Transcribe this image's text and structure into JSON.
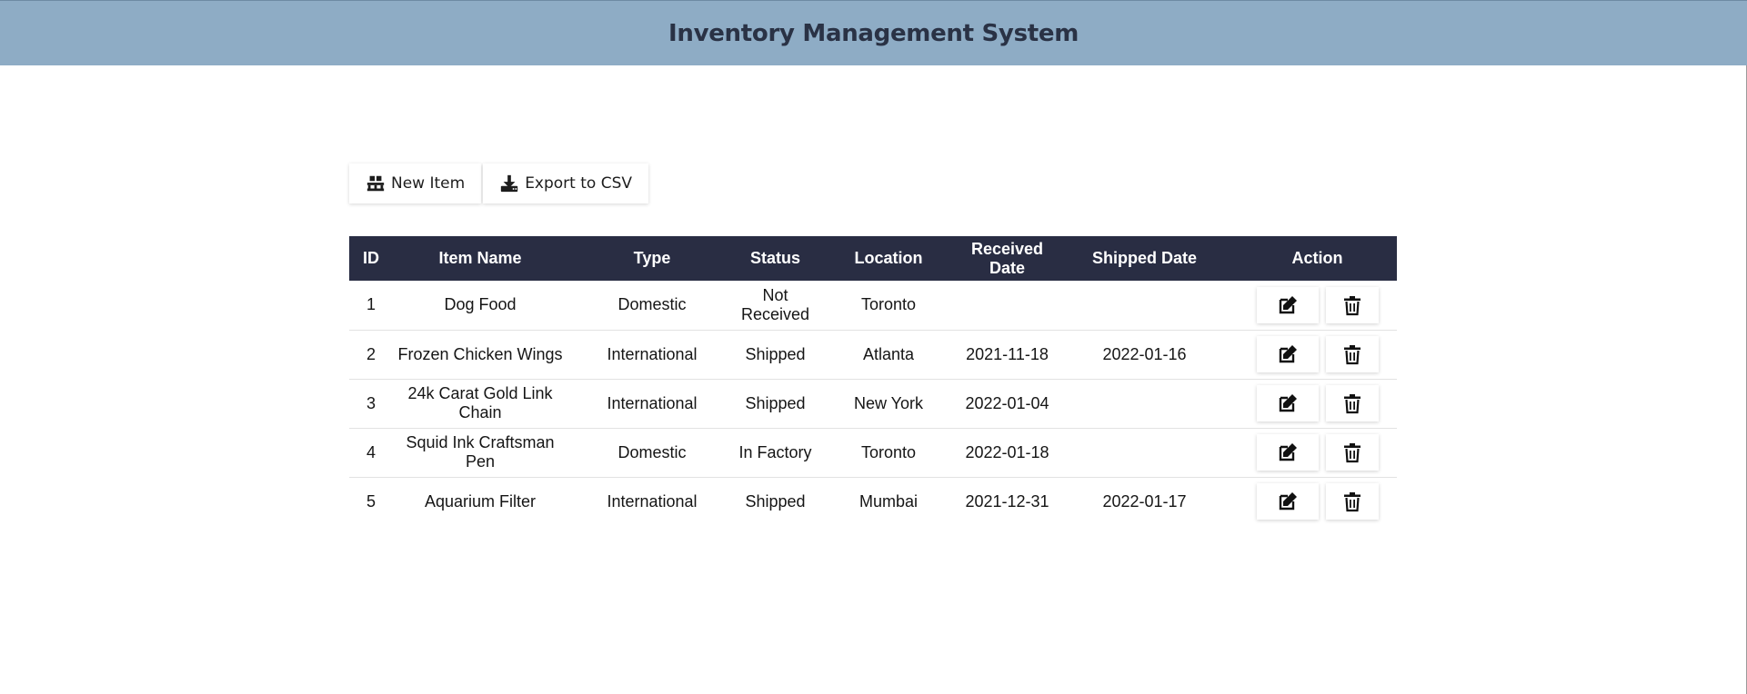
{
  "app": {
    "title": "Inventory Management System"
  },
  "toolbar": {
    "new_item_label": "New Item",
    "new_item_icon": "pallet-icon",
    "export_label": "Export to CSV",
    "export_icon": "download-icon"
  },
  "table": {
    "columns": [
      "ID",
      "Item Name",
      "Type",
      "Status",
      "Location",
      "Received Date",
      "Shipped Date",
      "Action"
    ],
    "rows": [
      {
        "id": "1",
        "name": "Dog Food",
        "type": "Domestic",
        "status": "Not Received",
        "location": "Toronto",
        "received": "",
        "shipped": ""
      },
      {
        "id": "2",
        "name": "Frozen Chicken Wings",
        "type": "International",
        "status": "Shipped",
        "location": "Atlanta",
        "received": "2021-11-18",
        "shipped": "2022-01-16"
      },
      {
        "id": "3",
        "name": "24k Carat Gold Link Chain",
        "type": "International",
        "status": "Shipped",
        "location": "New York",
        "received": "2022-01-04",
        "shipped": ""
      },
      {
        "id": "4",
        "name": "Squid Ink Craftsman Pen",
        "type": "Domestic",
        "status": "In Factory",
        "location": "Toronto",
        "received": "2022-01-18",
        "shipped": ""
      },
      {
        "id": "5",
        "name": "Aquarium Filter",
        "type": "International",
        "status": "Shipped",
        "location": "Mumbai",
        "received": "2021-12-31",
        "shipped": "2022-01-17"
      }
    ],
    "row_actions": {
      "edit_icon": "edit-icon",
      "delete_icon": "trash-icon"
    }
  },
  "colors": {
    "header_bg": "#8eacc5",
    "table_header_bg": "#292d43",
    "title_text": "#2a3245"
  }
}
